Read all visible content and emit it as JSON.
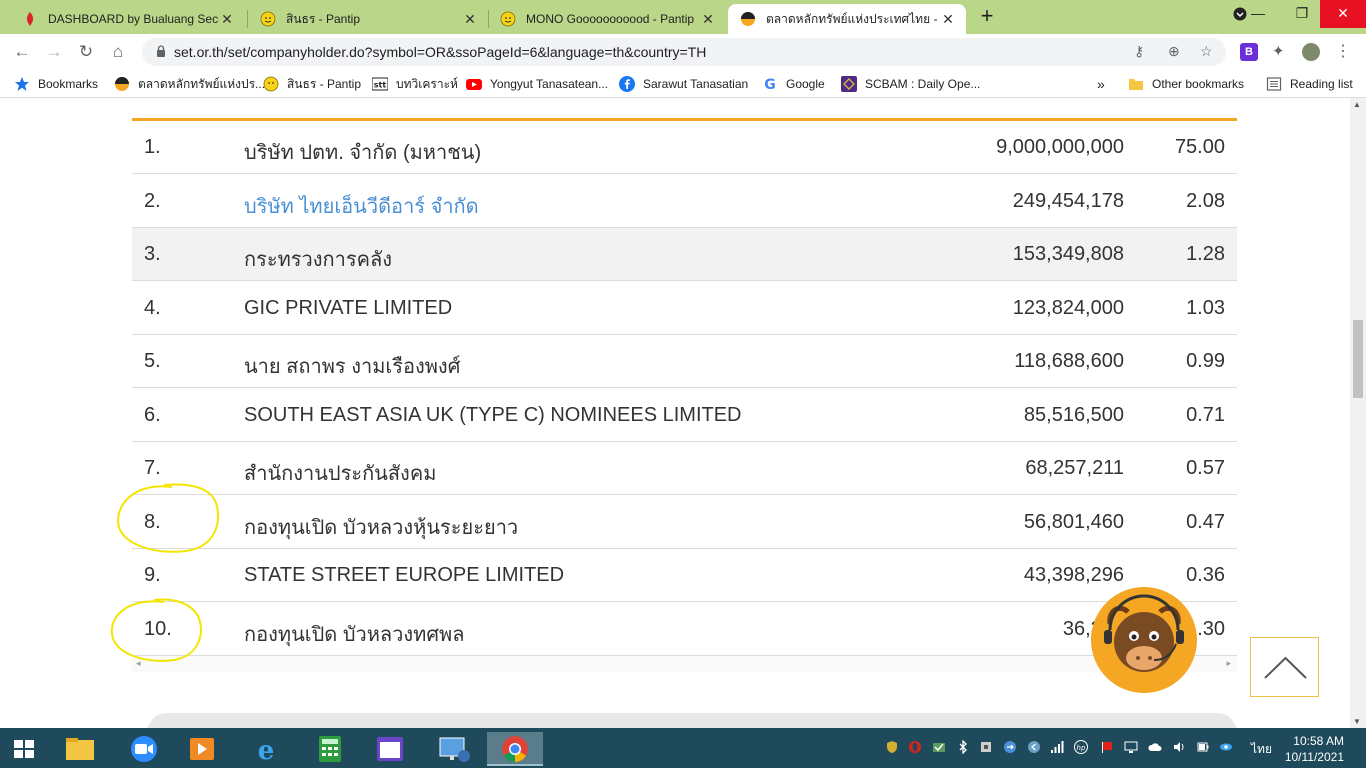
{
  "browser": {
    "tabs": [
      {
        "title": "DASHBOARD by Bualuang Securi",
        "active": false,
        "favicon": "bualuang-flame-icon"
      },
      {
        "title": "สินธร - Pantip",
        "active": false,
        "favicon": "pantip-emoji-icon"
      },
      {
        "title": "MONO Gooooooooood - Pantip",
        "active": false,
        "favicon": "pantip-emoji-icon"
      },
      {
        "title": "ตลาดหลักทรัพย์แห่งประเทศไทย - ข้อมู",
        "active": true,
        "favicon": "set-logo-icon"
      }
    ],
    "url": "set.or.th/set/companyholder.do?symbol=OR&ssoPageId=6&language=th&country=TH",
    "bookmarks": [
      {
        "label": "Bookmarks",
        "icon": "star-icon"
      },
      {
        "label": "ตลาดหลักทรัพย์แห่งปร...",
        "icon": "set-logo-icon"
      },
      {
        "label": "สินธร - Pantip",
        "icon": "pantip-emoji-icon"
      },
      {
        "label": "บทวิเคราะห์",
        "icon": "stt-icon"
      },
      {
        "label": "Yongyut Tanasatean...",
        "icon": "youtube-icon"
      },
      {
        "label": "Sarawut Tanasatian",
        "icon": "facebook-icon"
      },
      {
        "label": "Google",
        "icon": "google-icon"
      },
      {
        "label": "SCBAM : Daily Ope...",
        "icon": "scbam-icon"
      }
    ],
    "bookmarks_overflow": "»",
    "other_bookmarks": "Other bookmarks",
    "reading_list": "Reading list",
    "profile_badge": "B"
  },
  "shareholders": {
    "rows": [
      {
        "no": "1.",
        "name": "บริษัท ปตท. จำกัด (มหาชน)",
        "shares": "9,000,000,000",
        "pct": "75.00",
        "link": false
      },
      {
        "no": "2.",
        "name": "บริษัท ไทยเอ็นวีดีอาร์ จำกัด",
        "shares": "249,454,178",
        "pct": "2.08",
        "link": true
      },
      {
        "no": "3.",
        "name": "กระทรวงการคลัง",
        "shares": "153,349,808",
        "pct": "1.28",
        "link": false
      },
      {
        "no": "4.",
        "name": "GIC PRIVATE LIMITED",
        "shares": "123,824,000",
        "pct": "1.03",
        "link": false
      },
      {
        "no": "5.",
        "name": "นาย สถาพร งามเรืองพงศ์",
        "shares": "118,688,600",
        "pct": "0.99",
        "link": false
      },
      {
        "no": "6.",
        "name": "SOUTH EAST ASIA UK (TYPE C) NOMINEES LIMITED",
        "shares": "85,516,500",
        "pct": "0.71",
        "link": false
      },
      {
        "no": "7.",
        "name": "สำนักงานประกันสังคม",
        "shares": "68,257,211",
        "pct": "0.57",
        "link": false
      },
      {
        "no": "8.",
        "name": "กองทุนเปิด บัวหลวงหุ้นระยะยาว",
        "shares": "56,801,460",
        "pct": "0.47",
        "link": false
      },
      {
        "no": "9.",
        "name": "STATE STREET EUROPE LIMITED",
        "shares": "43,398,296",
        "pct": "0.36",
        "link": false
      },
      {
        "no": "10.",
        "name": "กองทุนเปิด บัวหลวงทศพล",
        "shares": "36,310",
        "pct": ".30",
        "link": false
      }
    ]
  },
  "taskbar": {
    "time": "10:58 AM",
    "date": "10/11/2021",
    "language": "ไทย"
  },
  "colors": {
    "tabstrip": "#b9d689",
    "accent_orange": "#f5a623",
    "link_blue": "#4a8fd6",
    "annotation_yellow": "#f2e600",
    "taskbar": "#1f4a5c"
  }
}
